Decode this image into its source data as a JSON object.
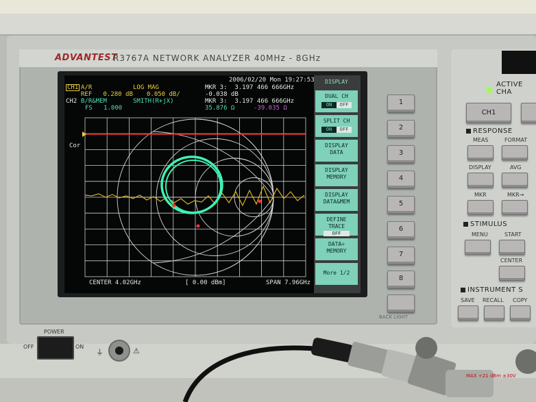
{
  "header": {
    "brand": "ADVANTEST",
    "model_line": "R3767A  NETWORK  ANALYZER  40MHz - 8GHz"
  },
  "screen": {
    "datetime": "2006/02/20 Mon 19:27:53",
    "ch1": {
      "label": "CH1",
      "param": "A/R",
      "format": "LOG MAG",
      "ref": "REF   0.280 dB",
      "scale": "0.050 dB/",
      "marker": "MKR 3:  3.197 466 666GHz",
      "marker_value": "-0.038 dB"
    },
    "ch2": {
      "label": "CH2",
      "param": "B/R&MEM",
      "format": "SMITH(R+jX)",
      "fs": "FS   1.000",
      "marker": "MKR 3:  3.197 466 666GHz",
      "marker_r": "35.876 Ω",
      "marker_x": "-39.035 Ω"
    },
    "cor_label": "Cor",
    "footer": {
      "center": "CENTER 4.02GHz",
      "power": "[ 0.00 dBm]",
      "span": "SPAN 7.96GHz"
    }
  },
  "softkeys": {
    "title": "DISPLAY",
    "items": [
      {
        "label": "DUAL CH",
        "on": "ON",
        "off": "OFF",
        "has_toggle": true
      },
      {
        "label": "SPLIT CH",
        "on": "ON",
        "off": "OFF",
        "has_toggle": true
      },
      {
        "label": "DISPLAY\nDATA",
        "has_toggle": false
      },
      {
        "label": "DISPLAY\nMEMORY",
        "has_toggle": false
      },
      {
        "label": "DISPLAY\nDATA&MEM",
        "has_toggle": false
      },
      {
        "label": "DEFINE\nTRACE",
        "sub": "OFF",
        "has_toggle": false
      },
      {
        "label": "DATA÷\nMEMORY",
        "has_toggle": false
      },
      {
        "label": "More 1/2",
        "has_toggle": false
      }
    ]
  },
  "number_keys": [
    "1",
    "2",
    "3",
    "4",
    "5",
    "6",
    "7",
    "8"
  ],
  "backlight_label": "BACK LIGHT",
  "right_panel": {
    "active_ch": "ACTIVE CHA",
    "ch1_key": "CH1",
    "response": "RESPONSE",
    "meas": "MEAS",
    "format": "FORMAT",
    "display": "DISPLAY",
    "avg": "AVG",
    "mkr": "MKR",
    "mkr_arrow": "MKR→",
    "stimulus": "STIMULUS",
    "menu": "MENU",
    "start": "START",
    "center": "CENTER",
    "instrument": "INSTRUMENT  S",
    "save": "SAVE",
    "recall": "RECALL",
    "copy": "COPY"
  },
  "bottom": {
    "power": "POWER",
    "off": "OFF",
    "on": "ON",
    "max_label": "MAX +21 dBm ±30V"
  },
  "colors": {
    "lcd_bg": "#050606",
    "grid": "#d8d8d8",
    "trace_yellow": "#d8b020",
    "trace_cyan": "#3ff2b2",
    "ref_line": "#e02020",
    "ch1_label": "#e8d040",
    "ch2_label": "#50e0b8",
    "softkey": "#7fd1b9"
  }
}
